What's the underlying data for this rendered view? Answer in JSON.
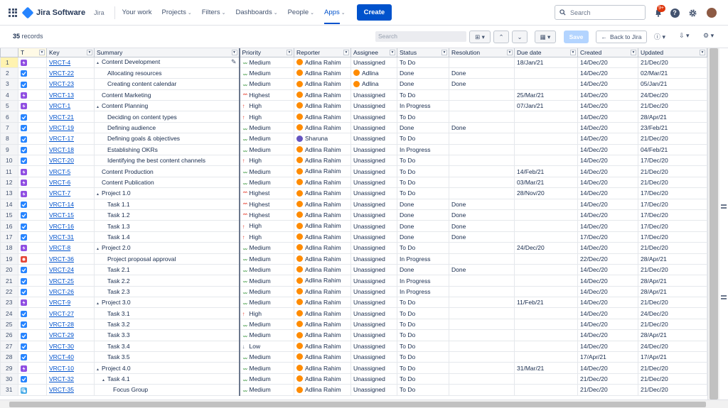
{
  "nav": {
    "product": "Jira Software",
    "product_small": "Jira",
    "items": [
      {
        "label": "Your work",
        "active": false
      },
      {
        "label": "Projects",
        "active": false
      },
      {
        "label": "Filters",
        "active": false
      },
      {
        "label": "Dashboards",
        "active": false
      },
      {
        "label": "People",
        "active": false
      },
      {
        "label": "Apps",
        "active": true
      }
    ],
    "create": "Create",
    "search_placeholder": "Search",
    "notifications_count": "9+"
  },
  "toolbar": {
    "records_count": "35",
    "records_label": "records",
    "search_placeholder": "Search",
    "save": "Save",
    "back": "Back to Jira"
  },
  "columns": [
    "T",
    "Key",
    "Summary",
    "Priority",
    "Reporter",
    "Assignee",
    "Status",
    "Resolution",
    "Due date",
    "Created",
    "Updated"
  ],
  "rows": [
    {
      "n": "1",
      "type": "epic",
      "key": "VRCT-4",
      "summary": "Content Development",
      "level": 0,
      "expand": true,
      "priority": "Medium",
      "reporter": "Adlina Rahim",
      "assignee": "Unassigned",
      "assignee_av": "",
      "status": "To Do",
      "resolution": "",
      "due": "18/Jan/21",
      "created": "14/Dec/20",
      "updated": "21/Dec/20"
    },
    {
      "n": "2",
      "type": "task",
      "key": "VRCT-22",
      "summary": "Allocating resources",
      "level": 2,
      "expand": false,
      "priority": "Medium",
      "reporter": "Adlina Rahim",
      "assignee": "Adlina",
      "assignee_av": "orange",
      "status": "Done",
      "resolution": "Done",
      "due": "",
      "created": "14/Dec/20",
      "updated": "02/Mar/21"
    },
    {
      "n": "3",
      "type": "task",
      "key": "VRCT-23",
      "summary": "Creating content calendar",
      "level": 2,
      "expand": false,
      "priority": "Medium",
      "reporter": "Adlina Rahim",
      "assignee": "Adlina",
      "assignee_av": "orange",
      "status": "Done",
      "resolution": "Done",
      "due": "",
      "created": "14/Dec/20",
      "updated": "05/Jan/21"
    },
    {
      "n": "4",
      "type": "epic",
      "key": "VRCT-13",
      "summary": "Content Marketing",
      "level": 1,
      "expand": false,
      "priority": "Highest",
      "reporter": "Adlina Rahim",
      "assignee": "Unassigned",
      "assignee_av": "",
      "status": "To Do",
      "resolution": "",
      "due": "25/Mar/21",
      "created": "14/Dec/20",
      "updated": "24/Dec/20"
    },
    {
      "n": "5",
      "type": "epic",
      "key": "VRCT-1",
      "summary": "Content Planning",
      "level": 0,
      "expand": true,
      "priority": "High",
      "reporter": "Adlina Rahim",
      "assignee": "Unassigned",
      "assignee_av": "",
      "status": "In Progress",
      "resolution": "",
      "due": "07/Jan/21",
      "created": "14/Dec/20",
      "updated": "21/Dec/20"
    },
    {
      "n": "6",
      "type": "task",
      "key": "VRCT-21",
      "summary": "Deciding on content types",
      "level": 2,
      "expand": false,
      "priority": "High",
      "reporter": "Adlina Rahim",
      "assignee": "Unassigned",
      "assignee_av": "",
      "status": "To Do",
      "resolution": "",
      "due": "",
      "created": "14/Dec/20",
      "updated": "28/Apr/21"
    },
    {
      "n": "7",
      "type": "task",
      "key": "VRCT-19",
      "summary": "Defining audience",
      "level": 2,
      "expand": false,
      "priority": "Medium",
      "reporter": "Adlina Rahim",
      "assignee": "Unassigned",
      "assignee_av": "",
      "status": "Done",
      "resolution": "Done",
      "due": "",
      "created": "14/Dec/20",
      "updated": "23/Feb/21"
    },
    {
      "n": "8",
      "type": "task",
      "key": "VRCT-17",
      "summary": "Defining goals & objectives",
      "level": 2,
      "expand": false,
      "priority": "Medium",
      "reporter": "Sharuna",
      "reporter_av": "purple",
      "assignee": "Unassigned",
      "assignee_av": "",
      "status": "To Do",
      "resolution": "",
      "due": "",
      "created": "14/Dec/20",
      "updated": "21/Dec/20"
    },
    {
      "n": "9",
      "type": "task",
      "key": "VRCT-18",
      "summary": "Establishing OKRs",
      "level": 2,
      "expand": false,
      "priority": "Medium",
      "reporter": "Adlina Rahim",
      "assignee": "Unassigned",
      "assignee_av": "",
      "status": "In Progress",
      "resolution": "",
      "due": "",
      "created": "14/Dec/20",
      "updated": "04/Feb/21"
    },
    {
      "n": "10",
      "type": "task",
      "key": "VRCT-20",
      "summary": "Identifying the best content channels",
      "level": 2,
      "expand": false,
      "priority": "High",
      "reporter": "Adlina Rahim",
      "assignee": "Unassigned",
      "assignee_av": "",
      "status": "To Do",
      "resolution": "",
      "due": "",
      "created": "14/Dec/20",
      "updated": "17/Dec/20"
    },
    {
      "n": "11",
      "type": "epic",
      "key": "VRCT-5",
      "summary": "Content Production",
      "level": 1,
      "expand": false,
      "priority": "Medium",
      "reporter": "Adlina Rahim",
      "assignee": "Unassigned",
      "assignee_av": "",
      "status": "To Do",
      "resolution": "",
      "due": "14/Feb/21",
      "created": "14/Dec/20",
      "updated": "21/Dec/20"
    },
    {
      "n": "12",
      "type": "epic",
      "key": "VRCT-6",
      "summary": "Content Publication",
      "level": 1,
      "expand": false,
      "priority": "Medium",
      "reporter": "Adlina Rahim",
      "assignee": "Unassigned",
      "assignee_av": "",
      "status": "To Do",
      "resolution": "",
      "due": "03/Mar/21",
      "created": "14/Dec/20",
      "updated": "21/Dec/20"
    },
    {
      "n": "13",
      "type": "epic",
      "key": "VRCT-7",
      "summary": "Project 1.0",
      "level": 0,
      "expand": true,
      "priority": "Highest",
      "reporter": "Adlina Rahim",
      "assignee": "Unassigned",
      "assignee_av": "",
      "status": "To Do",
      "resolution": "",
      "due": "28/Nov/20",
      "created": "14/Dec/20",
      "updated": "17/Dec/20"
    },
    {
      "n": "14",
      "type": "task",
      "key": "VRCT-14",
      "summary": "Task 1.1",
      "level": 2,
      "expand": false,
      "priority": "Highest",
      "reporter": "Adlina Rahim",
      "assignee": "Unassigned",
      "assignee_av": "",
      "status": "Done",
      "resolution": "Done",
      "due": "",
      "created": "14/Dec/20",
      "updated": "17/Dec/20"
    },
    {
      "n": "15",
      "type": "task",
      "key": "VRCT-15",
      "summary": "Task 1.2",
      "level": 2,
      "expand": false,
      "priority": "Highest",
      "reporter": "Adlina Rahim",
      "assignee": "Unassigned",
      "assignee_av": "",
      "status": "Done",
      "resolution": "Done",
      "due": "",
      "created": "14/Dec/20",
      "updated": "17/Dec/20"
    },
    {
      "n": "16",
      "type": "task",
      "key": "VRCT-16",
      "summary": "Task 1.3",
      "level": 2,
      "expand": false,
      "priority": "High",
      "reporter": "Adlina Rahim",
      "assignee": "Unassigned",
      "assignee_av": "",
      "status": "Done",
      "resolution": "Done",
      "due": "",
      "created": "14/Dec/20",
      "updated": "17/Dec/20"
    },
    {
      "n": "17",
      "type": "task",
      "key": "VRCT-31",
      "summary": "Task 1.4",
      "level": 2,
      "expand": false,
      "priority": "High",
      "reporter": "Adlina Rahim",
      "assignee": "Unassigned",
      "assignee_av": "",
      "status": "Done",
      "resolution": "Done",
      "due": "",
      "created": "17/Dec/20",
      "updated": "17/Dec/20"
    },
    {
      "n": "18",
      "type": "epic",
      "key": "VRCT-8",
      "summary": "Project 2.0",
      "level": 0,
      "expand": true,
      "priority": "Medium",
      "reporter": "Adlina Rahim",
      "assignee": "Unassigned",
      "assignee_av": "",
      "status": "To Do",
      "resolution": "",
      "due": "24/Dec/20",
      "created": "14/Dec/20",
      "updated": "21/Dec/20"
    },
    {
      "n": "19",
      "type": "bug",
      "key": "VRCT-36",
      "summary": "Project proposal approval",
      "level": 2,
      "expand": false,
      "priority": "Medium",
      "reporter": "Adlina Rahim",
      "assignee": "Unassigned",
      "assignee_av": "",
      "status": "In Progress",
      "resolution": "",
      "due": "",
      "created": "22/Dec/20",
      "updated": "28/Apr/21"
    },
    {
      "n": "20",
      "type": "task",
      "key": "VRCT-24",
      "summary": "Task 2.1",
      "level": 2,
      "expand": false,
      "priority": "Medium",
      "reporter": "Adlina Rahim",
      "assignee": "Unassigned",
      "assignee_av": "",
      "status": "Done",
      "resolution": "Done",
      "due": "",
      "created": "14/Dec/20",
      "updated": "21/Dec/20"
    },
    {
      "n": "21",
      "type": "task",
      "key": "VRCT-25",
      "summary": "Task 2.2",
      "level": 2,
      "expand": false,
      "priority": "Medium",
      "reporter": "Adlina Rahim",
      "assignee": "Unassigned",
      "assignee_av": "",
      "status": "In Progress",
      "resolution": "",
      "due": "",
      "created": "14/Dec/20",
      "updated": "28/Apr/21"
    },
    {
      "n": "22",
      "type": "task",
      "key": "VRCT-26",
      "summary": "Task 2.3",
      "level": 2,
      "expand": false,
      "priority": "Medium",
      "reporter": "Adlina Rahim",
      "assignee": "Unassigned",
      "assignee_av": "",
      "status": "In Progress",
      "resolution": "",
      "due": "",
      "created": "14/Dec/20",
      "updated": "28/Apr/21"
    },
    {
      "n": "23",
      "type": "epic",
      "key": "VRCT-9",
      "summary": "Project 3.0",
      "level": 0,
      "expand": true,
      "priority": "Medium",
      "reporter": "Adlina Rahim",
      "assignee": "Unassigned",
      "assignee_av": "",
      "status": "To Do",
      "resolution": "",
      "due": "11/Feb/21",
      "created": "14/Dec/20",
      "updated": "21/Dec/20"
    },
    {
      "n": "24",
      "type": "task",
      "key": "VRCT-27",
      "summary": "Task 3.1",
      "level": 2,
      "expand": false,
      "priority": "High",
      "reporter": "Adlina Rahim",
      "assignee": "Unassigned",
      "assignee_av": "",
      "status": "To Do",
      "resolution": "",
      "due": "",
      "created": "14/Dec/20",
      "updated": "24/Dec/20"
    },
    {
      "n": "25",
      "type": "task",
      "key": "VRCT-28",
      "summary": "Task 3.2",
      "level": 2,
      "expand": false,
      "priority": "Medium",
      "reporter": "Adlina Rahim",
      "assignee": "Unassigned",
      "assignee_av": "",
      "status": "To Do",
      "resolution": "",
      "due": "",
      "created": "14/Dec/20",
      "updated": "21/Dec/20"
    },
    {
      "n": "26",
      "type": "task",
      "key": "VRCT-29",
      "summary": "Task 3.3",
      "level": 2,
      "expand": false,
      "priority": "Medium",
      "reporter": "Adlina Rahim",
      "assignee": "Unassigned",
      "assignee_av": "",
      "status": "To Do",
      "resolution": "",
      "due": "",
      "created": "14/Dec/20",
      "updated": "28/Apr/21"
    },
    {
      "n": "27",
      "type": "task",
      "key": "VRCT-30",
      "summary": "Task 3.4",
      "level": 2,
      "expand": false,
      "priority": "Low",
      "reporter": "Adlina Rahim",
      "assignee": "Unassigned",
      "assignee_av": "",
      "status": "To Do",
      "resolution": "",
      "due": "",
      "created": "14/Dec/20",
      "updated": "24/Dec/20"
    },
    {
      "n": "28",
      "type": "task",
      "key": "VRCT-40",
      "summary": "Task 3.5",
      "level": 2,
      "expand": false,
      "priority": "Medium",
      "reporter": "Adlina Rahim",
      "assignee": "Unassigned",
      "assignee_av": "",
      "status": "To Do",
      "resolution": "",
      "due": "",
      "created": "17/Apr/21",
      "updated": "17/Apr/21"
    },
    {
      "n": "29",
      "type": "epic",
      "key": "VRCT-10",
      "summary": "Project 4.0",
      "level": 0,
      "expand": true,
      "priority": "Medium",
      "reporter": "Adlina Rahim",
      "assignee": "Unassigned",
      "assignee_av": "",
      "status": "To Do",
      "resolution": "",
      "due": "31/Mar/21",
      "created": "14/Dec/20",
      "updated": "21/Dec/20"
    },
    {
      "n": "30",
      "type": "task",
      "key": "VRCT-32",
      "summary": "Task 4.1",
      "level": 1,
      "expand": true,
      "priority": "Medium",
      "reporter": "Adlina Rahim",
      "assignee": "Unassigned",
      "assignee_av": "",
      "status": "To Do",
      "resolution": "",
      "due": "",
      "created": "21/Dec/20",
      "updated": "21/Dec/20"
    },
    {
      "n": "31",
      "type": "sub",
      "key": "VRCT-35",
      "summary": "Focus Group",
      "level": 3,
      "expand": false,
      "priority": "Medium",
      "reporter": "Adlina Rahim",
      "assignee": "Unassigned",
      "assignee_av": "",
      "status": "To Do",
      "resolution": "",
      "due": "",
      "created": "21/Dec/20",
      "updated": "21/Dec/20"
    }
  ]
}
